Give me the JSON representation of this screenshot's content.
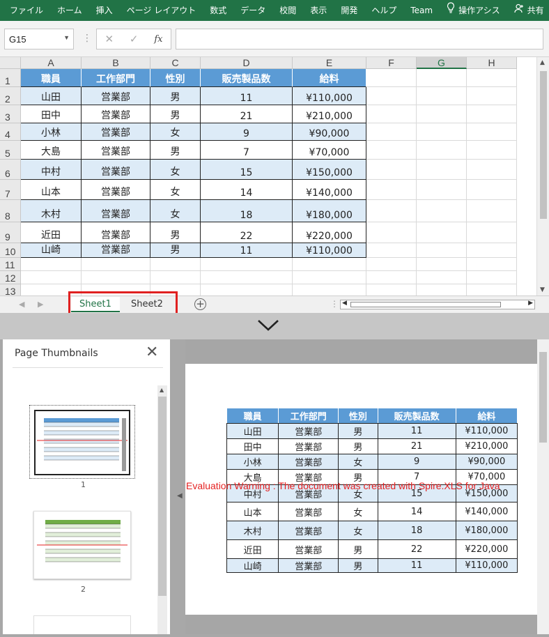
{
  "ribbon": {
    "tabs": [
      "ファイル",
      "ホーム",
      "挿入",
      "ページ レイアウト",
      "数式",
      "データ",
      "校閲",
      "表示",
      "開発",
      "ヘルプ",
      "Team"
    ],
    "tell_me": "操作アシス",
    "share": "共有"
  },
  "formula_bar": {
    "name_box": "G15",
    "cancel": "✕",
    "enter": "✓",
    "fx": "fx",
    "value": ""
  },
  "sheet": {
    "columns": [
      "A",
      "B",
      "C",
      "D",
      "E",
      "F",
      "G",
      "H"
    ],
    "selected_column": "G",
    "rows": [
      "1",
      "2",
      "3",
      "4",
      "5",
      "6",
      "7",
      "8",
      "9",
      "10",
      "11",
      "12",
      "13"
    ],
    "header": [
      "職員",
      "工作部門",
      "性別",
      "販売製品数",
      "給料"
    ],
    "data": [
      [
        "山田",
        "営業部",
        "男",
        "11",
        "¥110,000"
      ],
      [
        "田中",
        "営業部",
        "男",
        "21",
        "¥210,000"
      ],
      [
        "小林",
        "営業部",
        "女",
        "9",
        "¥90,000"
      ],
      [
        "大島",
        "営業部",
        "男",
        "7",
        "¥70,000"
      ],
      [
        "中村",
        "営業部",
        "女",
        "15",
        "¥150,000"
      ],
      [
        "山本",
        "営業部",
        "女",
        "14",
        "¥140,000"
      ],
      [
        "木村",
        "営業部",
        "女",
        "18",
        "¥180,000"
      ],
      [
        "近田",
        "営業部",
        "男",
        "22",
        "¥220,000"
      ],
      [
        "山崎",
        "営業部",
        "男",
        "11",
        "¥110,000"
      ]
    ]
  },
  "sheet_tabs": {
    "tabs": [
      "Sheet1",
      "Sheet2"
    ],
    "active": "Sheet1",
    "add": "+"
  },
  "thumbnails": {
    "title": "Page Thumbnails",
    "pages": [
      "1",
      "2"
    ]
  },
  "preview": {
    "watermark": "Evaluation Warning : The document was created with  Spire.XLS for Java"
  },
  "colors": {
    "ribbon": "#217346",
    "table_header": "#5b9bd5",
    "band": "#ddebf7",
    "highlight": "#e02020",
    "watermark": "#e52222"
  }
}
